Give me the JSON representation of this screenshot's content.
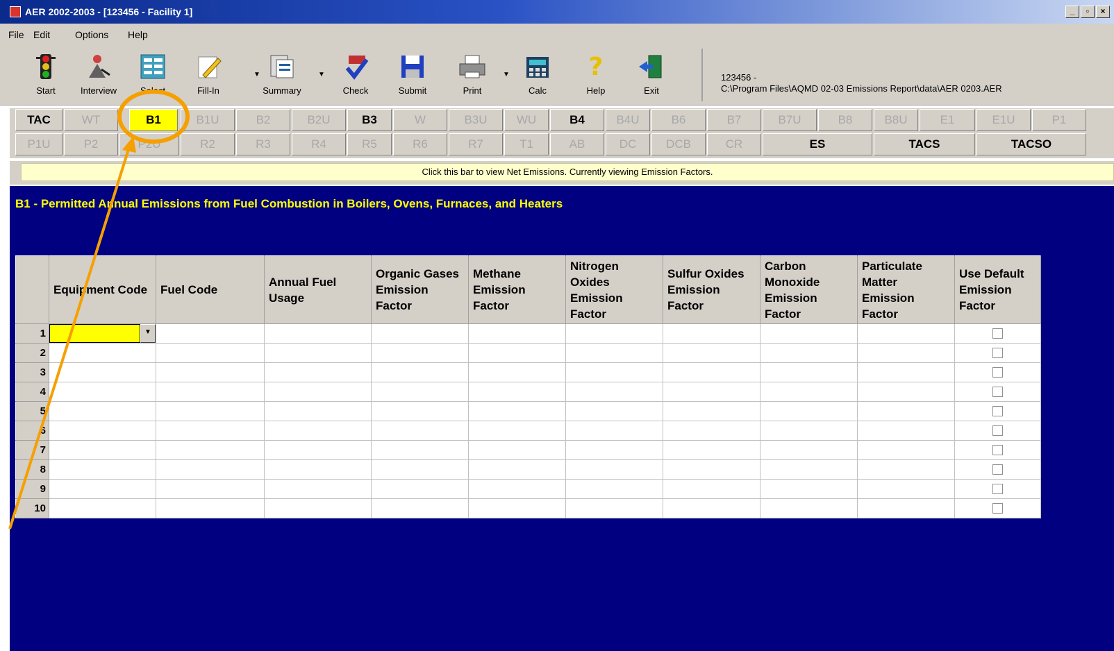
{
  "window": {
    "title": "AER 2002-2003 - [123456 - Facility 1]",
    "controls": [
      "_",
      "▫",
      "×"
    ]
  },
  "menu": [
    "File",
    "Edit",
    "Options",
    "Help"
  ],
  "toolbar": {
    "tools": [
      {
        "label": "Start",
        "icon": "traffic-light-icon"
      },
      {
        "label": "Interview",
        "icon": "interview-icon"
      },
      {
        "label": "Select",
        "icon": "select-form-icon"
      },
      {
        "label": "Fill-In",
        "icon": "pencil-icon"
      },
      {
        "label": "Summary",
        "icon": "summary-icon"
      },
      {
        "label": "Check",
        "icon": "check-icon"
      },
      {
        "label": "Submit",
        "icon": "floppy-disk-icon"
      },
      {
        "label": "Print",
        "icon": "printer-icon"
      },
      {
        "label": "Calc",
        "icon": "calculator-icon"
      },
      {
        "label": "Help",
        "icon": "help-icon"
      },
      {
        "label": "Exit",
        "icon": "exit-icon"
      }
    ],
    "path_line1": "123456 -",
    "path_line2": "C:\\Program Files\\AQMD 02-03 Emissions Report\\data\\AER 0203.AER"
  },
  "tabs_row1": [
    "TAC",
    "WT",
    "B1",
    "B1U",
    "B2",
    "B2U",
    "B3",
    "W",
    "B3U",
    "WU",
    "B4",
    "B4U",
    "B6",
    "B7",
    "B7U",
    "B8",
    "B8U",
    "E1",
    "E1U",
    "P1"
  ],
  "tabs_row2": [
    "P1U",
    "P2",
    "P2U",
    "R2",
    "R3",
    "R4",
    "R5",
    "R6",
    "R7",
    "T1",
    "AB",
    "DC",
    "DCB",
    "CR",
    "ES",
    "TACS",
    "TACSO"
  ],
  "infobar": "Click this bar to view Net Emissions. Currently viewing Emission Factors.",
  "section_title": "B1 - Permitted Annual Emissions from Fuel Combustion in Boilers, Ovens, Furnaces, and Heaters",
  "grid": {
    "columns": [
      "Equipment Code",
      "Fuel Code",
      "Annual Fuel Usage",
      "Organic Gases Emission Factor",
      "Methane Emission Factor",
      "Nitrogen Oxides Emission Factor",
      "Sulfur Oxides Emission Factor",
      "Carbon Monoxide Emission Factor",
      "Particulate Matter Emission Factor",
      "Use Default Emission Factor"
    ],
    "rows": [
      "1",
      "2",
      "3",
      "4",
      "5",
      "6",
      "7",
      "8",
      "9",
      "10"
    ]
  },
  "colors": {
    "title_gradient_start": "#0a2a8c",
    "panel": "#d4d0c8",
    "main_bg": "#000080",
    "section_title": "#ffff00",
    "selected_tab": "#ffff00",
    "infobar_bg": "#ffffcc",
    "annotation": "#f5a000"
  }
}
